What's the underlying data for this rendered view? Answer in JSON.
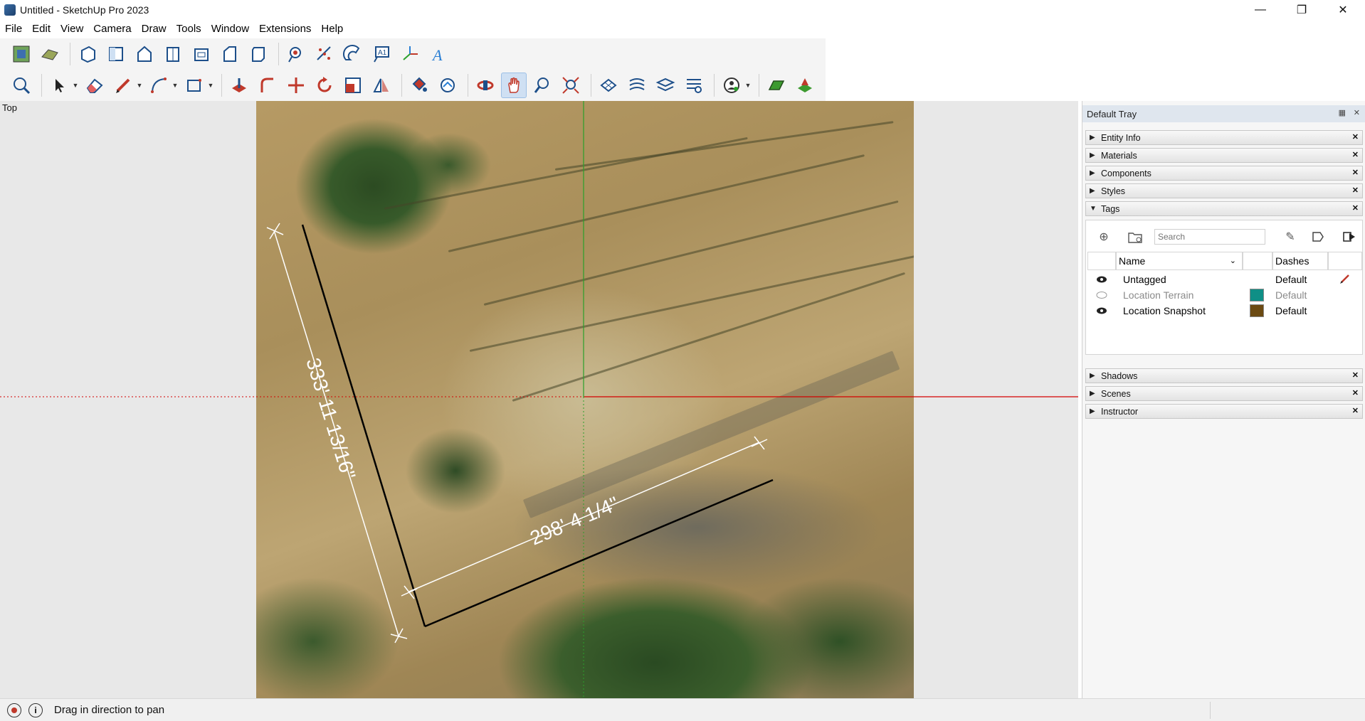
{
  "window": {
    "title": "Untitled - SketchUp Pro 2023"
  },
  "menu": [
    "File",
    "Edit",
    "View",
    "Camera",
    "Draw",
    "Tools",
    "Window",
    "Extensions",
    "Help"
  ],
  "toolbar1_icons": [
    "add-location-icon",
    "terrain-icon",
    "iso-view-icon",
    "top-view-icon",
    "front-view-icon",
    "right-view-icon",
    "back-view-icon",
    "left-view-icon",
    "bottom-view-icon",
    "tape-measure-icon",
    "dimension-icon",
    "protractor-icon",
    "text-icon",
    "axes-icon",
    "3d-text-icon"
  ],
  "toolbar2_icons": [
    "search-icon",
    "select-icon",
    "eraser-icon",
    "pencil-icon",
    "arc-icon",
    "rectangle-icon",
    "push-pull-icon",
    "follow-me-icon",
    "move-icon",
    "rotate-icon",
    "scale-icon",
    "flip-icon",
    "paint-bucket-icon",
    "offset-icon",
    "orbit-icon",
    "pan-icon",
    "zoom-icon",
    "zoom-extents-icon",
    "sandbox-icon-1",
    "sandbox-icon-2",
    "sandbox-icon-3",
    "sandbox-icon-4",
    "profile-icon",
    "warehouse-icon",
    "extension-icon"
  ],
  "viewport": {
    "view_name": "Top",
    "dimension_1": "333' 11 13/16\"",
    "dimension_2": "298' 4 1/4\""
  },
  "tray": {
    "title": "Default Tray",
    "panels_top": [
      "Entity Info",
      "Materials",
      "Components",
      "Styles",
      "Tags"
    ],
    "panels_bottom": [
      "Shadows",
      "Scenes",
      "Instructor"
    ],
    "tags": {
      "search_placeholder": "Search",
      "col_name": "Name",
      "col_dashes": "Dashes",
      "rows": [
        {
          "name": "Untagged",
          "dashes": "Default",
          "color": "",
          "visible": true
        },
        {
          "name": "Location Terrain",
          "dashes": "Default",
          "color": "#0f8f86",
          "visible": false
        },
        {
          "name": "Location Snapshot",
          "dashes": "Default",
          "color": "#6b4a12",
          "visible": true
        }
      ]
    }
  },
  "status": {
    "message": "Drag in direction to pan"
  },
  "colors": {
    "red_axis": "#d40000",
    "green_axis": "#2aa02a",
    "tray_header": "#dfe6ee"
  }
}
